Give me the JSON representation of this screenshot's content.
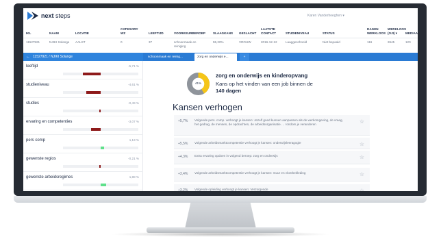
{
  "app": {
    "brand_bold": "next",
    "brand_light": "steps",
    "user": "Karen Vanderheeghen ▾"
  },
  "table": {
    "headers": [
      "IKL",
      "NAAM",
      "LOCATIE",
      "CATEGORY WZ",
      "LEEFTIJD",
      "VOORKEURBEROEP",
      "SLAAGKANS",
      "GESLACHT",
      "LAATSTE CONTACT",
      "STUDIENIVEAU",
      "STATUS",
      "DAGEN WERKLOOS",
      "WERKLOOS (OJI) ▾",
      "MEDIAAN"
    ],
    "row": [
      "11527921",
      "NJIKI Solange",
      "AALST",
      "0",
      "37",
      "schoonmaak en reiniging",
      "55,20%",
      "VROUW",
      "2016-12-12",
      "Laaggeschoold",
      "Niet bepaald",
      "116",
      "2645",
      "120"
    ]
  },
  "breadcrumb": {
    "arrow": "←",
    "label": "11527921 / NJIKI Solange"
  },
  "tabs": [
    "schoonmaak en reinig...",
    "zorg en onderwijs e...",
    "+"
  ],
  "factors": [
    {
      "name": "leeftijd",
      "pct": "-5,71 %",
      "value": -5.71
    },
    {
      "name": "studieniveau",
      "pct": "-4,61 %",
      "value": -4.61
    },
    {
      "name": "studies",
      "pct": "-0,49 %",
      "value": -0.49
    },
    {
      "name": "ervaring en competenties",
      "pct": "-3,07 %",
      "value": -3.07
    },
    {
      "name": "pers comp",
      "pct": "1,13 %",
      "value": 1.13
    },
    {
      "name": "gewenste regios",
      "pct": "-0,21 %",
      "value": -0.21
    },
    {
      "name": "gewenste arbeidsregimes",
      "pct": "1,88 %",
      "value": 1.88
    }
  ],
  "summary": {
    "donut_pct": "41%",
    "donut_value": 41,
    "sector": "zorg en onderwijs en kinderopvang",
    "chance_text": "Kans op het vinden van een job binnen de",
    "days": "140 dagen"
  },
  "kansen": {
    "heading": "Kansen verhogen",
    "suggestions": [
      {
        "pct": "+5,7%",
        "text": "Volgende pers. comp. verhoogt je kansen: Jezelf goed kunnen aanpassen als de werkomgeving, de vraag, het gedrag, de mensen, de opdrachten, de arbeidsorganisatie … rondom je veranderen"
      },
      {
        "pct": "+5,5%",
        "text": "Volgende arbeidsmarktcompetentie verhoogt je kansen: onderwijsleeragogie"
      },
      {
        "pct": "+4,3%",
        "text": "Extra ervaring opdoen in volgend beroep: zorg en onderwijs"
      },
      {
        "pct": "+3,4%",
        "text": "Volgende arbeidsmarktcompetentie verhoogt je kansen: muur en vloerbekleding"
      },
      {
        "pct": "+3,2%",
        "text": "Volgende opleiding verhoogt je kansen: Verzorgende"
      }
    ]
  },
  "colors": {
    "negative": "#8e1a1a",
    "positive": "#5fe08a",
    "accent": "#2a7bd4",
    "donut_fill": "#f5c518",
    "donut_rest": "#8f949b"
  },
  "icons": {
    "star": "☆"
  }
}
